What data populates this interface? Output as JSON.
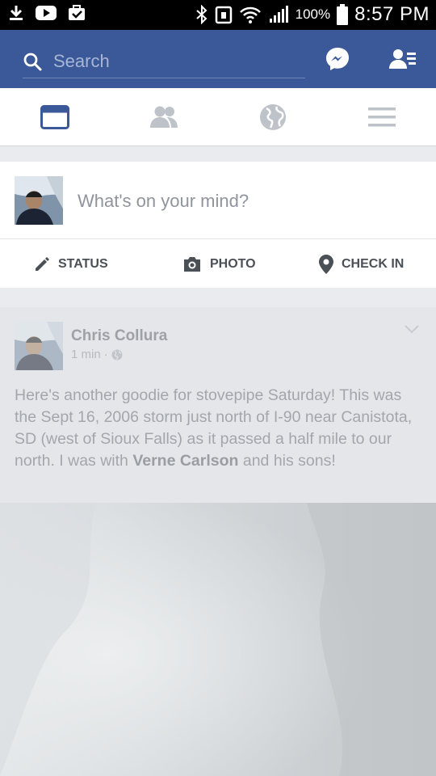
{
  "status_bar": {
    "battery": "100%",
    "time": "8:57 PM"
  },
  "search": {
    "placeholder": "Search"
  },
  "composer": {
    "prompt": "What's on your mind?",
    "actions": [
      {
        "label": "STATUS",
        "icon": "pencil-icon"
      },
      {
        "label": "PHOTO",
        "icon": "camera-icon"
      },
      {
        "label": "CHECK IN",
        "icon": "location-pin-icon"
      }
    ]
  },
  "nav_tabs": [
    {
      "icon": "news-feed-icon",
      "active": true
    },
    {
      "icon": "friends-icon",
      "active": false
    },
    {
      "icon": "globe-icon",
      "active": false
    },
    {
      "icon": "menu-icon",
      "active": false
    }
  ],
  "post": {
    "author": "Chris Collura",
    "time": "1 min",
    "separator": "·",
    "text_1": "Here's another goodie for stovepipe Saturday! This was the Sept 16, 2006 storm just north of I-90 near Canistota, SD (west of Sioux Falls) as it passed a half mile to our north. I was with ",
    "tagged": "Verne Carlson",
    "text_2": " and his sons!"
  },
  "colors": {
    "brand_blue": "#3b5998",
    "active_tab": "#3b5998",
    "inactive_tab": "#bec3c9"
  }
}
